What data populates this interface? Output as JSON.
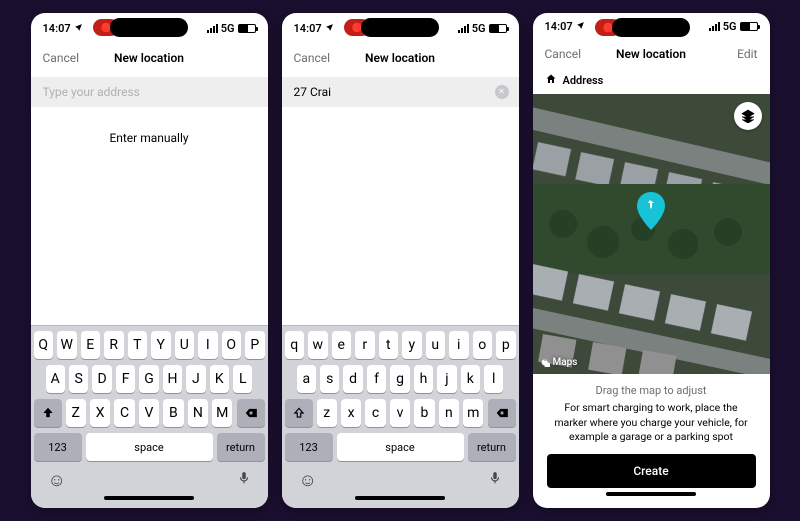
{
  "status": {
    "time": "14:07",
    "carrier": "5G"
  },
  "screens": [
    {
      "nav": {
        "left": "Cancel",
        "title": "New location",
        "right": ""
      },
      "search": {
        "placeholder": "Type your address",
        "value": ""
      },
      "enter_manually": "Enter manually",
      "keyboard_case": "upper"
    },
    {
      "nav": {
        "left": "Cancel",
        "title": "New location",
        "right": ""
      },
      "search": {
        "placeholder": "Type your address",
        "value": "27 Crai"
      },
      "keyboard_case": "lower"
    },
    {
      "nav": {
        "left": "Cancel",
        "title": "New location",
        "right": "Edit"
      },
      "address_label": "Address",
      "maps_attrib": "Maps",
      "hint1": "Drag the map to adjust",
      "hint2": "For smart charging to work, place the marker where you charge your vehicle, for example a garage or a parking spot",
      "create_label": "Create"
    }
  ],
  "keyboard": {
    "rows_upper": [
      [
        "Q",
        "W",
        "E",
        "R",
        "T",
        "Y",
        "U",
        "I",
        "O",
        "P"
      ],
      [
        "A",
        "S",
        "D",
        "F",
        "G",
        "H",
        "J",
        "K",
        "L"
      ],
      [
        "Z",
        "X",
        "C",
        "V",
        "B",
        "N",
        "M"
      ]
    ],
    "rows_lower": [
      [
        "q",
        "w",
        "e",
        "r",
        "t",
        "y",
        "u",
        "i",
        "o",
        "p"
      ],
      [
        "a",
        "s",
        "d",
        "f",
        "g",
        "h",
        "j",
        "k",
        "l"
      ],
      [
        "z",
        "x",
        "c",
        "v",
        "b",
        "n",
        "m"
      ]
    ],
    "num": "123",
    "space": "space",
    "return": "return"
  }
}
